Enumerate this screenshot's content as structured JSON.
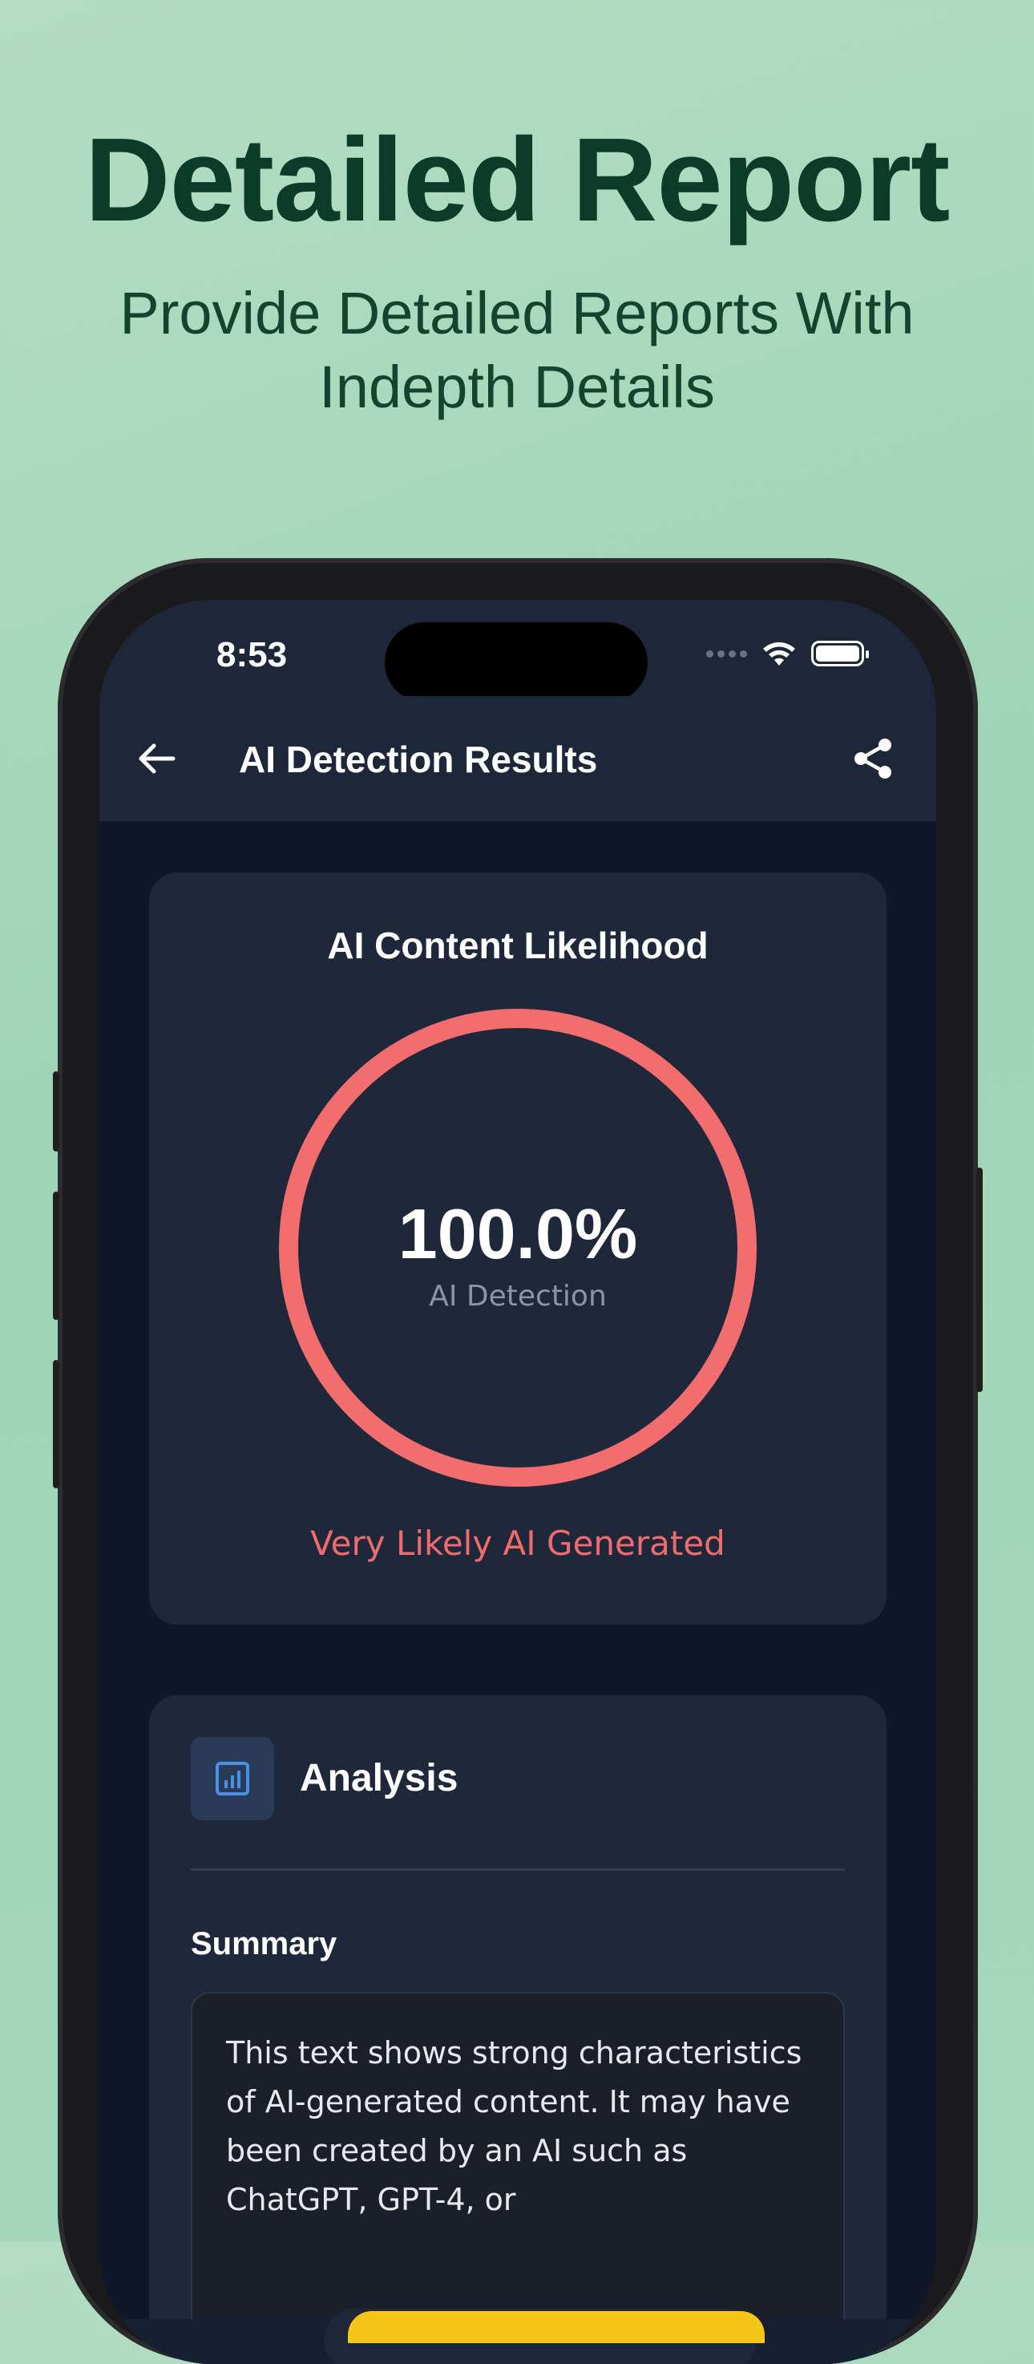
{
  "promo": {
    "headline": "Detailed Report",
    "subline": "Provide Detailed Reports With Indepth Details"
  },
  "status_bar": {
    "time": "8:53",
    "icons": [
      "signal-dots-icon",
      "wifi-icon",
      "battery-icon"
    ]
  },
  "app_bar": {
    "back_icon": "arrow-left-icon",
    "title": "AI Detection Results",
    "share_icon": "share-icon"
  },
  "likelihood_card": {
    "title": "AI Content Likelihood",
    "value": "100.0%",
    "value_fraction": 1.0,
    "label": "AI Detection",
    "verdict": "Very Likely AI Generated",
    "ring_color": "#f26d6d"
  },
  "analysis_card": {
    "icon": "bar-chart-icon",
    "title": "Analysis",
    "summary_heading": "Summary",
    "summary_text": "This text shows strong characteristics of AI-generated content. It may have been created by an AI such as ChatGPT, GPT-4, or"
  },
  "colors": {
    "background": "#a8d9bf",
    "headline": "#0d3b29",
    "screen_bg": "#0f1729",
    "card_bg": "#1f283a",
    "accent_red": "#f26d6d",
    "accent_blue": "#4a8fe7",
    "cta_yellow": "#f5c518"
  }
}
